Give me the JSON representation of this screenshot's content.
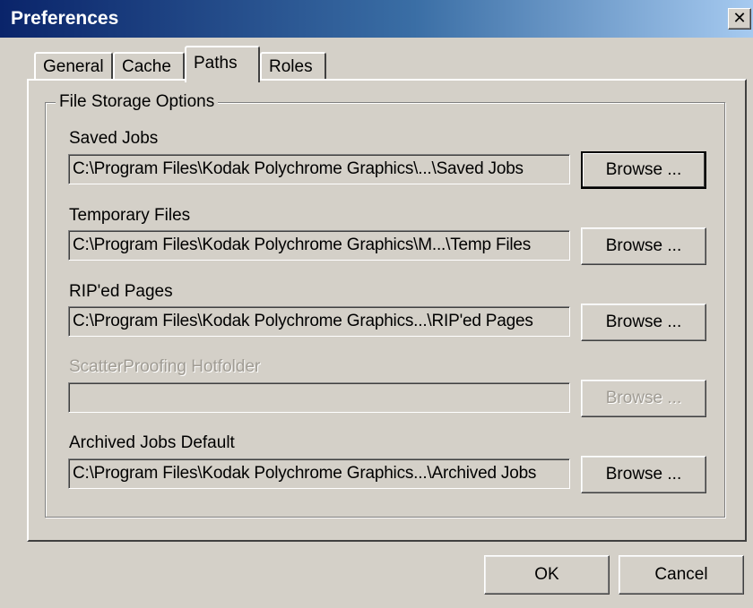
{
  "window": {
    "title": "Preferences",
    "close_glyph": "✕"
  },
  "tabs": [
    {
      "label": "General",
      "active": false
    },
    {
      "label": "Cache",
      "active": false
    },
    {
      "label": "Paths",
      "active": true
    },
    {
      "label": "Roles",
      "active": false
    }
  ],
  "group": {
    "legend": "File Storage Options"
  },
  "fields": [
    {
      "label": "Saved Jobs",
      "value": "C:\\Program Files\\Kodak Polychrome Graphics\\...\\Saved Jobs",
      "button": "Browse ...",
      "enabled": true
    },
    {
      "label": "Temporary Files",
      "value": "C:\\Program Files\\Kodak Polychrome Graphics\\M...\\Temp Files",
      "button": "Browse ...",
      "enabled": true
    },
    {
      "label": "RIP'ed Pages",
      "value": "C:\\Program Files\\Kodak Polychrome Graphics...\\RIP'ed Pages",
      "button": "Browse ...",
      "enabled": true
    },
    {
      "label": "ScatterProofing Hotfolder",
      "value": "",
      "button": "Browse ...",
      "enabled": false
    },
    {
      "label": "Archived Jobs Default",
      "value": "C:\\Program Files\\Kodak Polychrome Graphics...\\Archived Jobs",
      "button": "Browse ...",
      "enabled": true
    }
  ],
  "buttons": {
    "ok": "OK",
    "cancel": "Cancel"
  }
}
